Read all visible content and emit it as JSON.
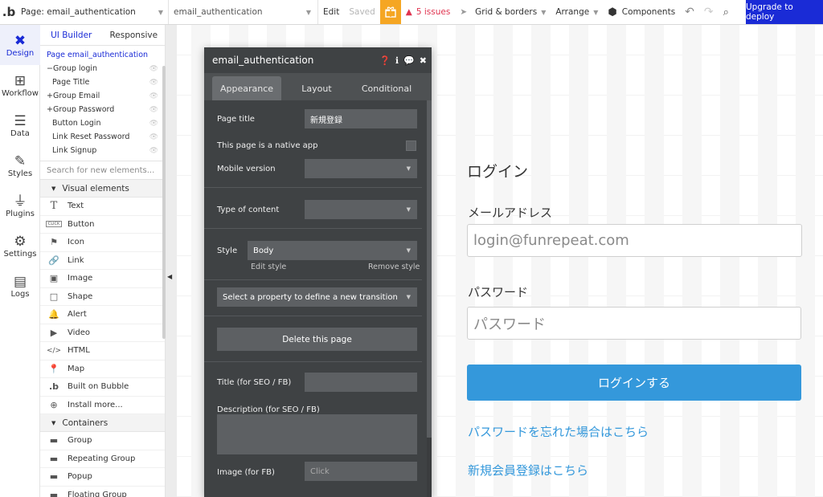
{
  "topbar": {
    "logo": ".b",
    "page_selector": "Page: email_authentication",
    "page_dropdown": "email_authentication",
    "edit": "Edit",
    "saved": "Saved",
    "issues": "5 issues",
    "grid": "Grid & borders",
    "arrange": "Arrange",
    "components": "Components",
    "upgrade": "Upgrade to deploy"
  },
  "rail": {
    "items": [
      {
        "label": "Design",
        "icon": "design-icon"
      },
      {
        "label": "Workflow",
        "icon": "workflow-icon"
      },
      {
        "label": "Data",
        "icon": "database-icon"
      },
      {
        "label": "Styles",
        "icon": "brush-icon"
      },
      {
        "label": "Plugins",
        "icon": "plugin-icon"
      },
      {
        "label": "Settings",
        "icon": "gear-icon"
      },
      {
        "label": "Logs",
        "icon": "document-icon"
      }
    ]
  },
  "panel": {
    "tabs": [
      "UI Builder",
      "Responsive"
    ],
    "tree": [
      "Page email_authentication",
      "Group login",
      "Page Title",
      "Group Email",
      "Group Password",
      "Button Login",
      "Link Reset Password",
      "Link Signup"
    ],
    "search_placeholder": "Search for new elements...",
    "visual_section": "Visual elements",
    "visual_elements": [
      "Text",
      "Button",
      "Icon",
      "Link",
      "Image",
      "Shape",
      "Alert",
      "Video",
      "HTML",
      "Map",
      "Built on Bubble",
      "Install more..."
    ],
    "containers_section": "Containers",
    "containers": [
      "Group",
      "Repeating Group",
      "Popup",
      "Floating Group"
    ]
  },
  "editor": {
    "title": "email_authentication",
    "tabs": [
      "Appearance",
      "Layout",
      "Conditional"
    ],
    "page_title_label": "Page title",
    "page_title_value": "新規登録",
    "native_app_label": "This page is a native app",
    "mobile_version_label": "Mobile version",
    "type_of_content_label": "Type of content",
    "style_label": "Style",
    "style_value": "Body",
    "edit_style": "Edit style",
    "remove_style": "Remove style",
    "transition": "Select a property to define a new transition",
    "delete_page": "Delete this page",
    "seo_title_label": "Title (for SEO / FB)",
    "seo_desc_label": "Description (for SEO / FB)",
    "image_label": "Image (for FB)",
    "image_value": "Click"
  },
  "preview": {
    "title": "ログイン",
    "email_label": "メールアドレス",
    "email_placeholder": "login@funrepeat.com",
    "password_label": "パスワード",
    "password_placeholder": "パスワード",
    "login_button": "ログインする",
    "forgot_link": "パスワードを忘れた場合はこちら",
    "signup_link": "新規会員登録はこちら"
  }
}
